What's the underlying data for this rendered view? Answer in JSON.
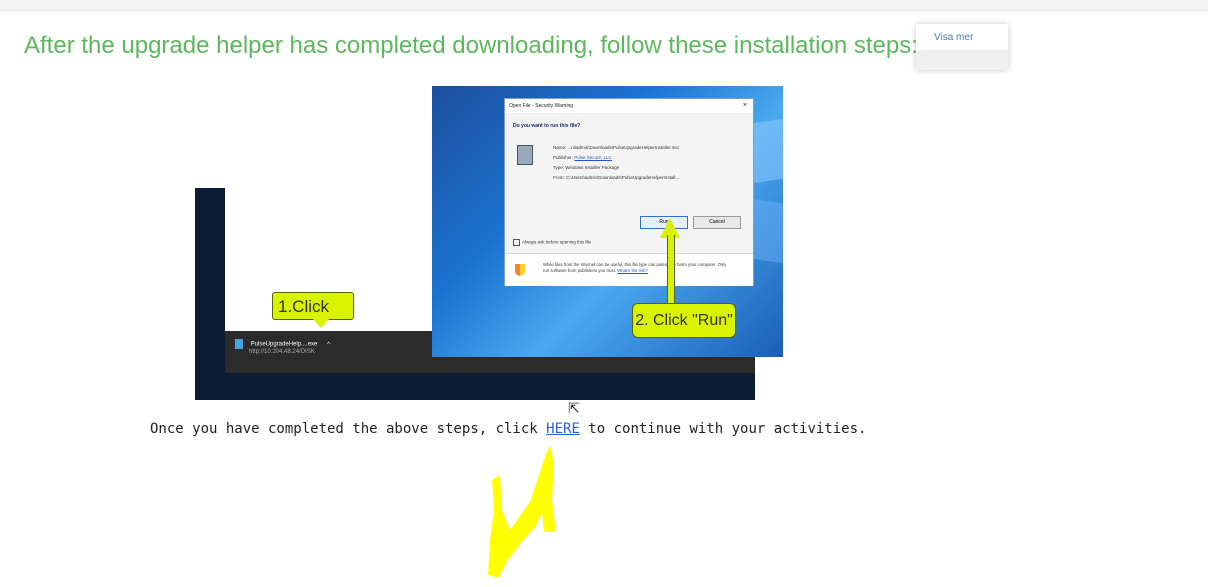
{
  "heading": "After the upgrade helper has completed downloading, follow these installation steps:",
  "visa_mer": "Visa mer",
  "callout_1": "1.Click",
  "callout_2": "2. Click \"Run\"",
  "download_bar": {
    "file_name": "PulseUpgradeHelp....exe",
    "file_url": "http://10.204.48.24/DISK"
  },
  "dialog": {
    "title": "Open File - Security Warning",
    "close": "×",
    "question": "Do you want to run this file?",
    "name_label": "Name:",
    "name_value": "...ni\\admin\\Downloads\\PulseUpgradeHelperInstaller.msi",
    "publisher_label": "Publisher:",
    "publisher_value": "Pulse Secure, LLC",
    "type_label": "Type:",
    "type_value": "Windows Installer Package",
    "from_label": "From:",
    "from_value": "C:\\Users\\admin\\Downloads\\PulseUpgradeHelperInstall...",
    "run_label": "Run",
    "cancel_label": "Cancel",
    "always_ask": "Always ask before opening this file",
    "warning_text": "While files from the Internet can be useful, this file type can potentially harm your computer. Only run software from publishers you trust.",
    "warning_link": "What's the risk?"
  },
  "message_before": "Once you have completed the above steps, click ",
  "here_link": "HERE",
  "message_after": " to continue with your activities.",
  "colors": {
    "heading_green": "#5cb85c",
    "callout_yellow": "#d8f200",
    "link_blue": "#2a5fd6",
    "scribble_yellow": "#ffff00"
  }
}
